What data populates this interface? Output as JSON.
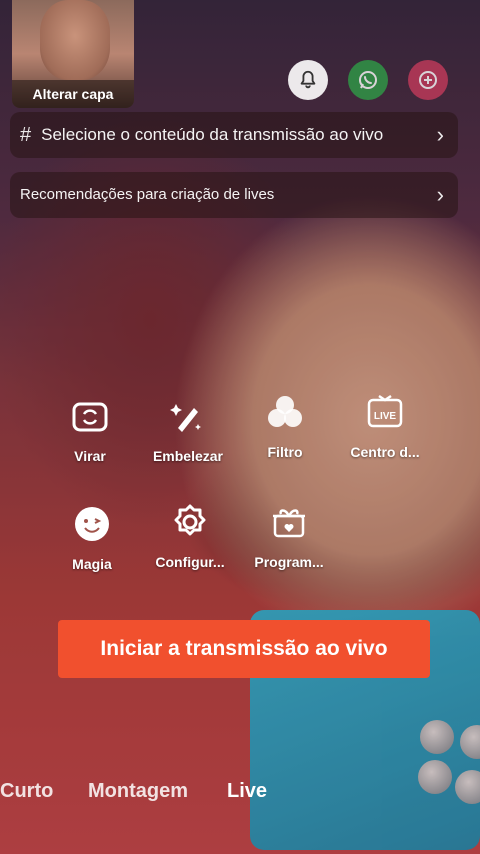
{
  "cover": {
    "label": "Alterar capa"
  },
  "header_icons": [
    "bell-icon",
    "whatsapp-icon",
    "plus-icon"
  ],
  "content_row": {
    "icon": "#",
    "label": "Selecione o conteúdo da transmissão ao vivo"
  },
  "recommend_row": {
    "label": "Recomendações para criação de lives"
  },
  "tools": [
    {
      "label": "Virar",
      "icon": "flip-camera-icon"
    },
    {
      "label": "Embelezar",
      "icon": "beautify-icon"
    },
    {
      "label": "Filtro",
      "icon": "filter-icon"
    },
    {
      "label": "Centro d...",
      "icon": "live-center-icon"
    },
    {
      "label": "Magia",
      "icon": "magic-icon"
    },
    {
      "label": "Configur...",
      "icon": "settings-icon"
    },
    {
      "label": "Program...",
      "icon": "gift-icon"
    }
  ],
  "cta": {
    "label": "Iniciar a transmissão ao vivo"
  },
  "tabs": {
    "curto": "Curto",
    "montagem": "Montagem",
    "live": "Live",
    "active": "Live"
  },
  "colors": {
    "cta": "#f1502e",
    "whatsapp": "#2f9c47",
    "plus": "#c33a5b"
  }
}
